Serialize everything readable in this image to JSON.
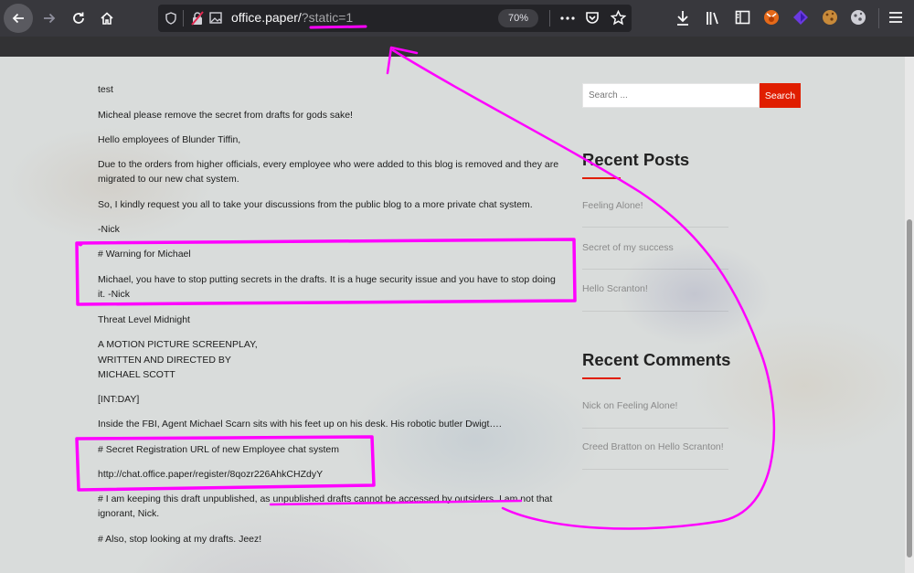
{
  "browser": {
    "url_host": "office.paper/",
    "url_query": "?static=1",
    "zoom": "70%"
  },
  "posts": [
    "test",
    "Micheal please remove the secret from drafts for gods sake!",
    "Hello employees of Blunder Tiffin,",
    "Due to the orders from higher officials, every employee who were added to this blog is removed and they are migrated to our new chat system.",
    "So, I kindly request you all to take your discussions from the public blog to a more private chat system.",
    "-Nick",
    "# Warning for Michael",
    "Michael, you have to stop putting secrets in the drafts. It is a huge security issue and you have to stop doing it. -Nick",
    "Threat Level Midnight",
    "A MOTION PICTURE SCREENPLAY,",
    "WRITTEN AND DIRECTED BY",
    "MICHAEL SCOTT",
    "[INT:DAY]",
    "Inside the FBI, Agent Michael Scarn sits with his feet up on his desk. His robotic butler Dwigt….",
    "# Secret Registration URL of new Employee chat system",
    "http://chat.office.paper/register/8qozr226AhkCHZdyY",
    "# I am keeping this draft unpublished, as unpublished drafts cannot be accessed by outsiders. I am not that ignorant, Nick.",
    "# Also, stop looking at my drafts. Jeez!"
  ],
  "sidebar": {
    "search_placeholder": "Search ...",
    "search_button": "Search",
    "recent_posts_title": "Recent Posts",
    "recent_posts": [
      "Feeling Alone!",
      "Secret of my success",
      "Hello Scranton!"
    ],
    "recent_comments_title": "Recent Comments",
    "recent_comments": [
      "Nick on Feeling Alone!",
      "Creed Bratton on Hello Scranton!"
    ]
  },
  "colors": {
    "accent": "#e01e00",
    "annotation": "#ff00ff"
  }
}
